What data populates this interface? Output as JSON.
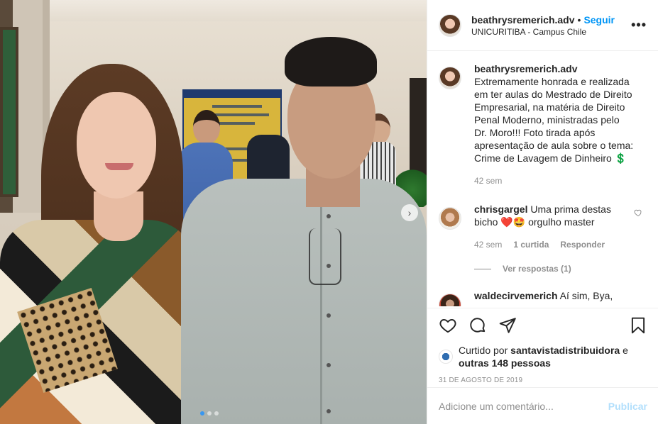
{
  "post": {
    "username": "beathrysremerich.adv",
    "follow_label": "Seguir",
    "separator": "•",
    "location": "UNICURITIBA - Campus Chile",
    "more_icon": "more-horizontal-icon",
    "caption_username": "beathrysremerich.adv",
    "caption_text": "Extremamente honrada e realizada em ter aulas do Mestrado de Direito Empresarial, na matéria de Direito Penal Moderno, ministradas pelo Dr. Moro!!! Foto tirada após apresentação de aula sobre o tema: Crime de Lavagem de Dinheiro 💲",
    "caption_time": "42 sem"
  },
  "comments": [
    {
      "username": "chrisgargel",
      "text": "Uma prima destas bicho ❤️🤩 orgulho master",
      "time": "42 sem",
      "likes": "1 curtida",
      "reply_label": "Responder",
      "view_replies": "Ver respostas (1)"
    },
    {
      "username": "waldecirvemerich",
      "text": "Aí sim, Bya,"
    }
  ],
  "actions": {
    "like_icon": "heart-icon",
    "comment_icon": "comment-icon",
    "share_icon": "share-icon",
    "save_icon": "bookmark-icon"
  },
  "likes": {
    "prefix": "Curtido por",
    "by": "santavistadistribuidora",
    "suffix": "e",
    "others": "outras 148 pessoas"
  },
  "date": "31 DE AGOSTO DE 2019",
  "add_comment": {
    "placeholder": "Adicione um comentário...",
    "publish_label": "Publicar"
  },
  "carousel": {
    "dots": 3,
    "active": 1
  },
  "colors": {
    "link": "#0095f6",
    "muted": "#8e8e8e",
    "heart_red": "#ed4956",
    "publish_disabled": "#b2dffc"
  }
}
